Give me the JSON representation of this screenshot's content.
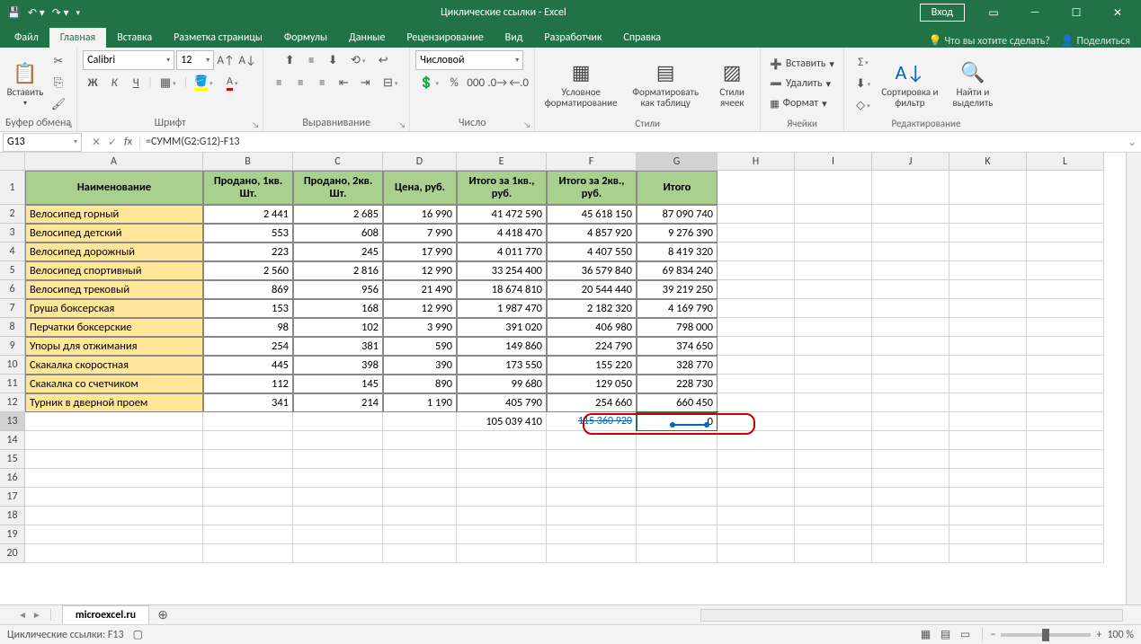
{
  "title": "Циклические ссылки - Excel",
  "signin": "Вход",
  "tabs": [
    "Файл",
    "Главная",
    "Вставка",
    "Разметка страницы",
    "Формулы",
    "Данные",
    "Рецензирование",
    "Вид",
    "Разработчик",
    "Справка"
  ],
  "tellme": "Что вы хотите сделать?",
  "share": "Поделиться",
  "ribbon": {
    "clipboard": {
      "label": "Буфер обмена",
      "paste": "Вставить"
    },
    "font": {
      "label": "Шрифт",
      "name": "Calibri",
      "size": "12",
      "bold": "Ж",
      "italic": "К",
      "underline": "Ч"
    },
    "align": {
      "label": "Выравнивание"
    },
    "number": {
      "label": "Число",
      "format": "Числовой"
    },
    "styles": {
      "label": "Стили",
      "cond": "Условное форматирование",
      "fmt": "Форматировать как таблицу",
      "cell": "Стили ячеек"
    },
    "cells": {
      "label": "Ячейки",
      "insert": "Вставить",
      "delete": "Удалить",
      "format": "Формат"
    },
    "editing": {
      "label": "Редактирование",
      "sort": "Сортировка и фильтр",
      "find": "Найти и выделить"
    }
  },
  "namebox": "G13",
  "formula": "=СУММ(G2:G12)-F13",
  "cols": [
    "A",
    "B",
    "C",
    "D",
    "E",
    "F",
    "G",
    "H",
    "I",
    "J",
    "K",
    "L"
  ],
  "hdr": [
    "Наименование",
    "Продано, 1кв. Шт.",
    "Продано, 2кв. Шт.",
    "Цена, руб.",
    "Итого за 1кв., руб.",
    "Итого за 2кв., руб.",
    "Итого"
  ],
  "rows": [
    [
      "Велосипед горный",
      "2 441",
      "2 685",
      "16 990",
      "41 472 590",
      "45 618 150",
      "87 090 740"
    ],
    [
      "Велосипед детский",
      "553",
      "608",
      "7 990",
      "4 418 470",
      "4 857 920",
      "9 276 390"
    ],
    [
      "Велосипед дорожный",
      "223",
      "245",
      "17 990",
      "4 011 770",
      "4 407 550",
      "8 419 320"
    ],
    [
      "Велосипед спортивный",
      "2 560",
      "2 816",
      "12 990",
      "33 254 400",
      "36 579 840",
      "69 834 240"
    ],
    [
      "Велосипед трековый",
      "869",
      "956",
      "21 490",
      "18 674 810",
      "20 544 440",
      "39 219 250"
    ],
    [
      "Груша боксерская",
      "153",
      "168",
      "12 990",
      "1 987 470",
      "2 182 320",
      "4 169 790"
    ],
    [
      "Перчатки боксерские",
      "98",
      "102",
      "3 990",
      "391 020",
      "406 980",
      "798 000"
    ],
    [
      "Упоры для отжимания",
      "254",
      "381",
      "590",
      "149 860",
      "224 790",
      "374 650"
    ],
    [
      "Скакалка скоростная",
      "445",
      "398",
      "390",
      "173 550",
      "155 220",
      "328 770"
    ],
    [
      "Скакалка со счетчиком",
      "112",
      "145",
      "890",
      "99 680",
      "129 050",
      "228 730"
    ],
    [
      "Турник в дверной проем",
      "341",
      "214",
      "1 190",
      "405 790",
      "254 660",
      "660 450"
    ]
  ],
  "totals": {
    "E": "105 039 410",
    "F": "115 360 920",
    "G": "0"
  },
  "sheet_tab": "microexcel.ru",
  "status": "Циклические ссылки: F13",
  "zoom": "100 %"
}
